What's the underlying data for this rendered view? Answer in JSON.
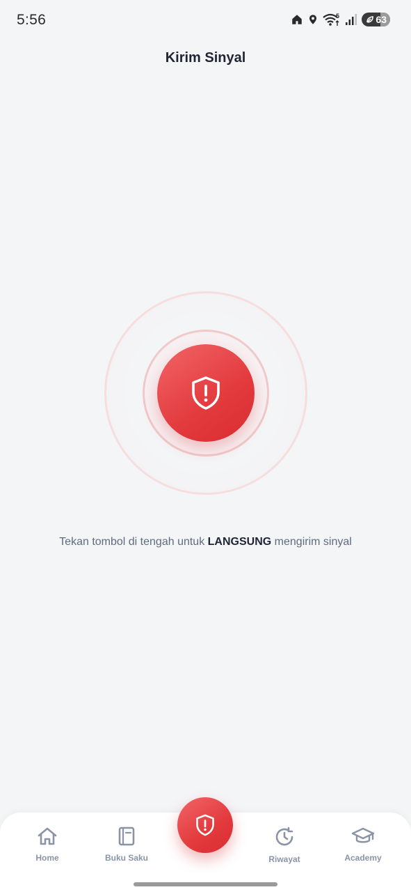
{
  "status_bar": {
    "time": "5:56",
    "network_label": "5",
    "battery": "63"
  },
  "header": {
    "title": "Kirim Sinyal"
  },
  "main": {
    "instruction_prefix": "Tekan tombol di tengah untuk ",
    "instruction_emphasis": "LANGSUNG",
    "instruction_suffix": " mengirim sinyal",
    "sos_icon": "shield-alert-icon"
  },
  "bottom_nav": {
    "items": [
      {
        "label": "Home",
        "icon": "home-icon"
      },
      {
        "label": "Buku Saku",
        "icon": "book-icon"
      },
      {
        "label": "Riwayat",
        "icon": "history-icon"
      },
      {
        "label": "Academy",
        "icon": "graduation-cap-icon"
      }
    ],
    "center_icon": "shield-alert-icon"
  },
  "colors": {
    "accent": "#E23A3D",
    "background": "#F4F5F7",
    "nav_inactive": "#8A94A6",
    "title": "#1E2433"
  }
}
